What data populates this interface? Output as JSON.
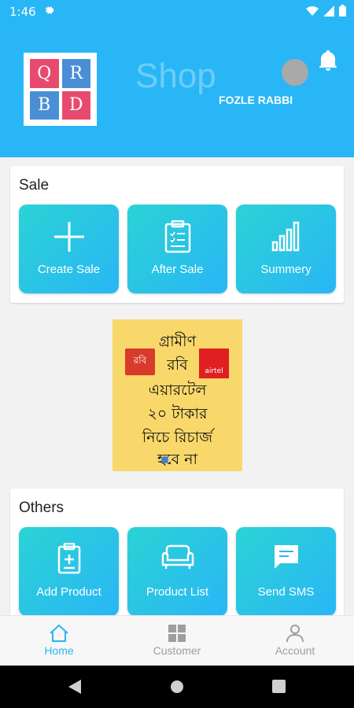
{
  "status_bar": {
    "time": "1:46"
  },
  "header": {
    "logo_letters": [
      "Q",
      "R",
      "B",
      "D"
    ],
    "shop_title": "Shop",
    "user_name": "FOZLE RABBI"
  },
  "sale_section": {
    "title": "Sale",
    "tiles": [
      {
        "label": "Create Sale",
        "icon": "plus-icon"
      },
      {
        "label": "After Sale",
        "icon": "clipboard-list-icon"
      },
      {
        "label": "Summery",
        "icon": "bar-chart-icon"
      }
    ]
  },
  "ad": {
    "lines": [
      "গ্রামীণ",
      "রবি",
      "এয়ারটেল",
      "২০ টাকার",
      "নিচে রিচার্জ",
      "হবে না"
    ],
    "robi_logo_text": "রবি",
    "airtel_logo_text": "airtel"
  },
  "others_section": {
    "title": "Others",
    "tiles": [
      {
        "label": "Add Product",
        "icon": "clipboard-plus-icon"
      },
      {
        "label": "Product List",
        "icon": "sofa-icon"
      },
      {
        "label": "Send SMS",
        "icon": "chat-bubble-icon"
      }
    ]
  },
  "bottom_nav": {
    "items": [
      {
        "label": "Home",
        "icon": "home-icon",
        "active": true
      },
      {
        "label": "Customer",
        "icon": "grid-icon",
        "active": false
      },
      {
        "label": "Account",
        "icon": "person-icon",
        "active": false
      }
    ],
    "active_color": "#29b6f6",
    "inactive_color": "#9e9e9e"
  },
  "colors": {
    "primary": "#29b6f6",
    "tile_gradient_start": "#2bd3d4",
    "ad_background": "#f9d86b"
  }
}
